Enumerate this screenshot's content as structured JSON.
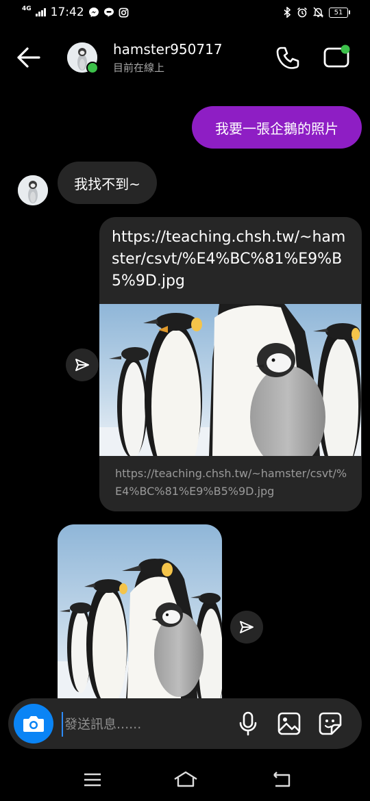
{
  "status_bar": {
    "network": "4G",
    "time": "17:42",
    "battery": "51",
    "left_icons": [
      "messenger-icon",
      "line-icon",
      "instagram-icon"
    ],
    "right_icons": [
      "bluetooth-icon",
      "alarm-icon",
      "mute-icon",
      "battery-icon"
    ]
  },
  "header": {
    "username": "hamster950717",
    "presence": "目前在線上",
    "icons": [
      "back-arrow-icon",
      "phone-icon",
      "video-call-icon"
    ],
    "online_color": "#3cc04a"
  },
  "messages": {
    "outgoing_1": "我要一張企鵝的照片",
    "incoming_1": "我找不到~",
    "link_text": "https://teaching.chsh.tw/~hamster/csvt/%E4%BC%81%E9%B5%9D.jpg",
    "link_caption": "https://teaching.chsh.tw/~hamster/csvt/%E4%BC%81%E9%B5%9D.jpg"
  },
  "composer": {
    "placeholder": "發送訊息......",
    "icons": [
      "camera-icon",
      "microphone-icon",
      "gallery-icon",
      "sticker-icon"
    ]
  },
  "colors": {
    "outgoing_bubble": "#8e1ec4",
    "incoming_bubble": "#262626",
    "camera_button": "#0a84f5"
  },
  "nav_icons": [
    "menu-icon",
    "home-icon",
    "back-icon"
  ]
}
